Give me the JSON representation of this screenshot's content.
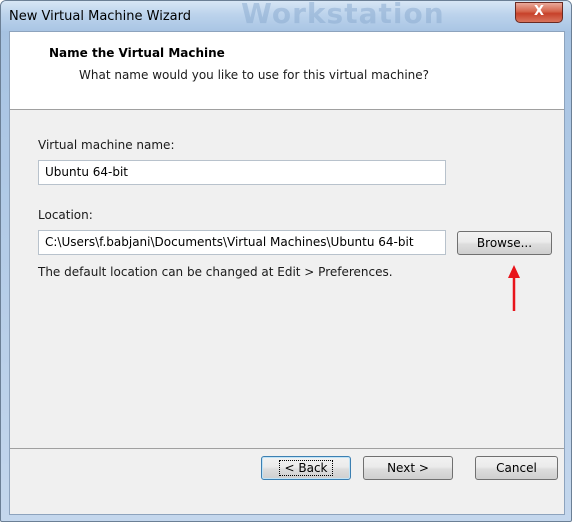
{
  "window": {
    "title": "New Virtual Machine Wizard",
    "close_glyph": "X",
    "watermark": "Workstation"
  },
  "header": {
    "title": "Name the Virtual Machine",
    "subtitle": "What name would you like to use for this virtual machine?"
  },
  "form": {
    "vm_name_label": "Virtual machine name:",
    "vm_name_value": "Ubuntu 64-bit",
    "location_label": "Location:",
    "location_value": "C:\\Users\\f.babjani\\Documents\\Virtual Machines\\Ubuntu 64-bit",
    "browse_label": "Browse...",
    "hint": "The default location can be changed at Edit > Preferences."
  },
  "footer": {
    "back_label": "< Back",
    "next_label": "Next >",
    "cancel_label": "Cancel"
  },
  "annotation": {
    "arrow_color": "#e8141b",
    "icon": "red-arrow-up-icon"
  }
}
